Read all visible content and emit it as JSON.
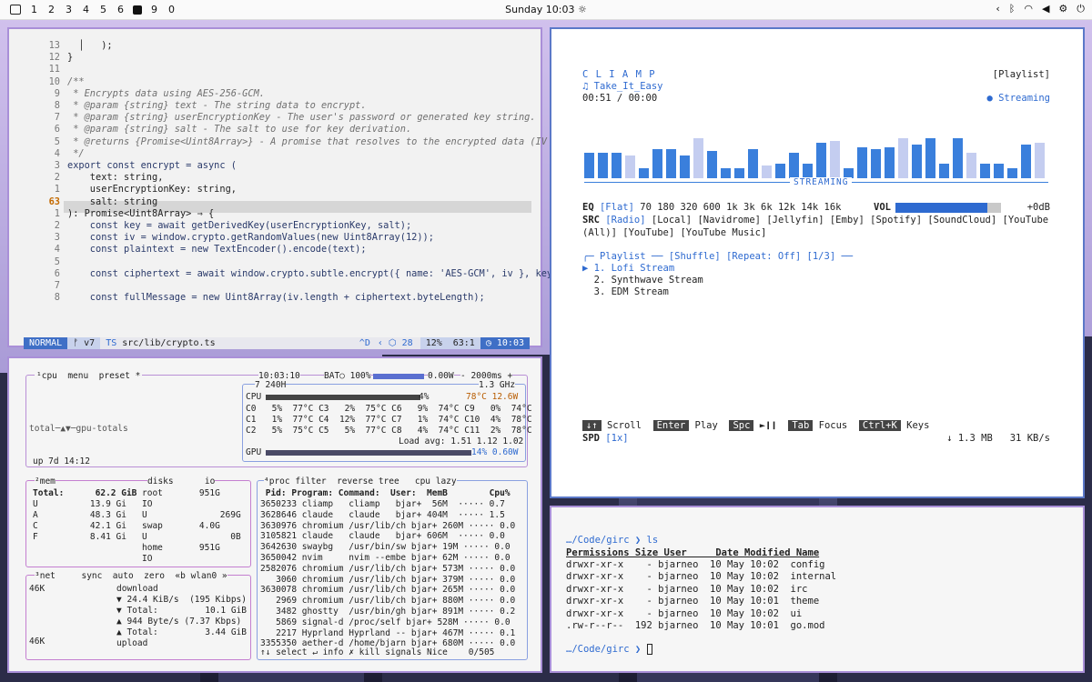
{
  "topbar": {
    "workspaces": [
      "1",
      "2",
      "3",
      "4",
      "5",
      "6",
      "9",
      "0"
    ],
    "clock": "Sunday 10:03"
  },
  "editor": {
    "lines": [
      {
        "n": "13",
        "code": "  │   );"
      },
      {
        "n": "12",
        "code": "}"
      },
      {
        "n": "11",
        "code": ""
      },
      {
        "n": "10",
        "code": "/**"
      },
      {
        "n": "9",
        "code": " * Encrypts data using AES-256-GCM."
      },
      {
        "n": "8",
        "code": " * @param {string} text - The string data to encrypt."
      },
      {
        "n": "7",
        "code": " * @param {string} userEncryptionKey - The user's password or generated key string."
      },
      {
        "n": "6",
        "code": " * @param {string} salt - The salt to use for key derivation."
      },
      {
        "n": "5",
        "code": " * @returns {Promise<Uint8Array>} - A promise that resolves to the encrypted data (IV"
      },
      {
        "n": "4",
        "code": " */"
      },
      {
        "n": "3",
        "code": "export const encrypt = async ("
      },
      {
        "n": "2",
        "code": "    text: string,"
      },
      {
        "n": "1",
        "code": "    userEncryptionKey: string,"
      },
      {
        "n": "63",
        "code": "    salt: string"
      },
      {
        "n": "1",
        "code": "): Promise<Uint8Array> ⇒ {"
      },
      {
        "n": "2",
        "code": "    const key = await getDerivedKey(userEncryptionKey, salt);"
      },
      {
        "n": "3",
        "code": "    const iv = window.crypto.getRandomValues(new Uint8Array(12));"
      },
      {
        "n": "4",
        "code": "    const plaintext = new TextEncoder().encode(text);"
      },
      {
        "n": "5",
        "code": ""
      },
      {
        "n": "6",
        "code": "    const ciphertext = await window.crypto.subtle.encrypt({ name: 'AES-GCM', iv }, key"
      },
      {
        "n": "7",
        "code": ""
      },
      {
        "n": "8",
        "code": "    const fullMessage = new Uint8Array(iv.length + ciphertext.byteLength);"
      }
    ],
    "status": {
      "mode": "NORMAL",
      "branch": "v7",
      "file": "src/lib/crypto.ts",
      "keys": "^D",
      "diag": "28",
      "pct": "12%",
      "pos": "63:1",
      "time": "10:03"
    }
  },
  "player": {
    "title": "C L I A M P",
    "playlist_label": "[Playlist]",
    "track": "♫ Take_It_Easy",
    "time": "00:51 / 00:00",
    "streaming": "● Streaming",
    "stream_caption": "STREAMING",
    "eq_label": "EQ",
    "eq_preset": "[Flat]",
    "eq_bands": "70 180 320 600 1k 3k 6k 12k 14k 16k",
    "vol_label": "VOL",
    "vol_value": "+0dB",
    "vol_level": 0.87,
    "src_label": "SRC",
    "sources": [
      "[Radio]",
      "[Local]",
      "[Navidrome]",
      "[Jellyfin]",
      "[Emby]",
      "[Spotify]",
      "[SoundCloud]",
      "[YouTube (All)]",
      "[YouTube]",
      "[YouTube Music]"
    ],
    "playlist_header": "╭─ Playlist ── [Shuffle] [Repeat: Off] [1/3] ──",
    "playlist": [
      "▶ 1. Lofi Stream",
      "  2. Synthwave Stream",
      "  3. EDM Stream"
    ],
    "help": [
      {
        "key": "↓↑",
        "label": "Scroll"
      },
      {
        "key": "Enter",
        "label": "Play"
      },
      {
        "key": "Spc",
        "label": "►❙❙"
      },
      {
        "key": "Tab",
        "label": "Focus"
      },
      {
        "key": "Ctrl+K",
        "label": "Keys"
      }
    ],
    "spd": "SPD [1x]",
    "net": "↓ 1.3 MB   31 KB/s",
    "visualizer_levels": [
      0.6,
      0.6,
      0.6,
      0.55,
      0.25,
      0.7,
      0.7,
      0.55,
      0.95,
      0.65,
      0.25,
      0.25,
      0.7,
      0.3,
      0.35,
      0.6,
      0.35,
      0.85,
      0.9,
      0.25,
      0.75,
      0.7,
      0.75,
      0.95,
      0.8,
      0.95,
      0.35,
      0.95,
      0.6,
      0.35,
      0.35,
      0.25,
      0.8,
      0.85
    ]
  },
  "btop": {
    "cpu_hdr": "¹cpu  menu  preset *",
    "clock": "10:03:10",
    "bat": "BAT○ 100%",
    "pwr": "0.00W",
    "rate": "- 2000ms +",
    "model": "7 240H",
    "ghz": "1.3 GHz",
    "cpu_row": "CPU",
    "cpu_pct": "4%",
    "cpu_temp": "78°C 12.6W",
    "cores": [
      "C0   5%  77°C C3   2%  75°C C6   9%  74°C C9   0%  74°C",
      "C1   1%  77°C C4  12%  77°C C7   1%  74°C C10  4%  78°C",
      "C2   5%  75°C C5   5%  77°C C8   4%  74°C C11  2%  78°C"
    ],
    "load": "Load avg: 1.51 1.12 1.02",
    "gpu": "GPU",
    "gpu_val": "14% 0.60W",
    "graph_label": "total─▲▼─gpu-totals",
    "uptime": "up 7d 14:12",
    "mem_hdr": "²mem",
    "mem_total": "Total:      62.2 GiB",
    "mem_rows": [
      "U          13.9 Gi",
      "A          48.3 Gi",
      "C          42.1 Gi",
      "F          8.41 Gi"
    ],
    "disks_hdr": "disks      io",
    "disks": [
      "root       951G",
      "IO",
      "U              269G",
      "swap       4.0G",
      "U                0B",
      "home       951G",
      "IO"
    ],
    "proc_hdr": "⁴proc filter  reverse tree   cpu lazy",
    "proc_cols": " Pid: Program: Command:  User:  MemB        Cpu%",
    "procs": [
      "3650233 cliamp   cliamp   bjar+  56M  ····· 0.7",
      "3628646 claude   claude   bjar+ 404M  ····· 1.5",
      "3630976 chromium /usr/lib/ch bjar+ 260M ····· 0.0",
      "3105821 claude   claude   bjar+ 606M  ····· 0.0",
      "3642630 swaybg   /usr/bin/sw bjar+ 19M ····· 0.0",
      "3650042 nvim     nvim --embe bjar+ 62M ····· 0.0",
      "2582076 chromium /usr/lib/ch bjar+ 573M ····· 0.0",
      "   3060 chromium /usr/lib/ch bjar+ 379M ····· 0.0",
      "3630078 chromium /usr/lib/ch bjar+ 265M ····· 0.0",
      "   2969 chromium /usr/lib/ch bjar+ 880M ····· 0.0",
      "   3482 ghostty  /usr/bin/gh bjar+ 891M ····· 0.2",
      "   5869 signal-d /proc/self bjar+ 528M ····· 0.0",
      "   2217 Hyprland Hyprland -- bjar+ 467M ····· 0.1",
      "3355350 aether-d /home/bjarn bjar+ 680M ····· 0.0"
    ],
    "proc_footer": "↑↓ select ↵ info ✗ kill signals Nice    0/505",
    "net_hdr": "³net     sync  auto  zero  «b wlan0 »",
    "net_top": "46K",
    "net_bot": "46K",
    "net_rows": [
      "download",
      "▼ 24.4 KiB/s  (195 Kibps)",
      "▼ Total:         10.1 GiB",
      "▲ 944 Byte/s (7.37 Kbps)",
      "▲ Total:         3.44 GiB",
      "upload"
    ]
  },
  "terminal": {
    "prompt1": "…/Code/girc ❯ ls",
    "header": "Permissions Size User     Date Modified Name",
    "rows": [
      "drwxr-xr-x    - bjarneo  10 May 10:02  config",
      "drwxr-xr-x    - bjarneo  10 May 10:02  internal",
      "drwxr-xr-x    - bjarneo  10 May 10:02  irc",
      "drwxr-xr-x    - bjarneo  10 May 10:01  theme",
      "drwxr-xr-x    - bjarneo  10 May 10:02  ui",
      ".rw-r--r--  192 bjarneo  10 May 10:01  go.mod"
    ],
    "prompt2": "…/Code/girc ❯ "
  }
}
